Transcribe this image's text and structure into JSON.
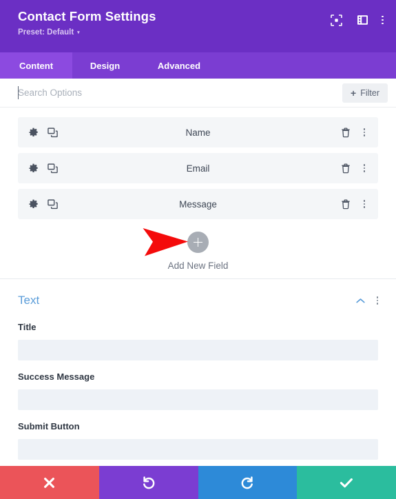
{
  "header": {
    "title": "Contact Form Settings",
    "preset_label": "Preset: Default",
    "preset_caret": "▾",
    "icons": {
      "fullscreen": "fullscreen-icon",
      "layout": "layout-panel-icon",
      "menu": "kebab-menu-icon"
    }
  },
  "tabs": [
    {
      "label": "Content",
      "active": true
    },
    {
      "label": "Design",
      "active": false
    },
    {
      "label": "Advanced",
      "active": false
    }
  ],
  "search": {
    "placeholder": "Search Options",
    "value": "",
    "filter_label": "Filter",
    "filter_plus": "+"
  },
  "fields": [
    {
      "label": "Name"
    },
    {
      "label": "Email"
    },
    {
      "label": "Message"
    }
  ],
  "add_field": {
    "label": "Add New Field",
    "annotation": "red-arrow-pointing-right"
  },
  "text_section": {
    "title": "Text",
    "groups": [
      {
        "label": "Title",
        "value": ""
      },
      {
        "label": "Success Message",
        "value": ""
      },
      {
        "label": "Submit Button",
        "value": ""
      }
    ]
  },
  "bottom_toolbar": [
    {
      "name": "cancel",
      "glyph": "✖",
      "color": "#eb5459"
    },
    {
      "name": "undo",
      "glyph": "↺",
      "color": "#7b3dd2"
    },
    {
      "name": "redo",
      "glyph": "↻",
      "color": "#2d8ad8"
    },
    {
      "name": "save",
      "glyph": "✔",
      "color": "#2bbd9e"
    }
  ],
  "colors": {
    "header_purple": "#6b2fc4",
    "tabbar_purple": "#7b3dd2",
    "active_tab_purple": "#8c4ae0",
    "section_title_blue": "#5b9dd9",
    "field_row_bg": "#f4f6f8",
    "input_bg": "#eef2f7",
    "arrow_red": "#f40b0b"
  }
}
